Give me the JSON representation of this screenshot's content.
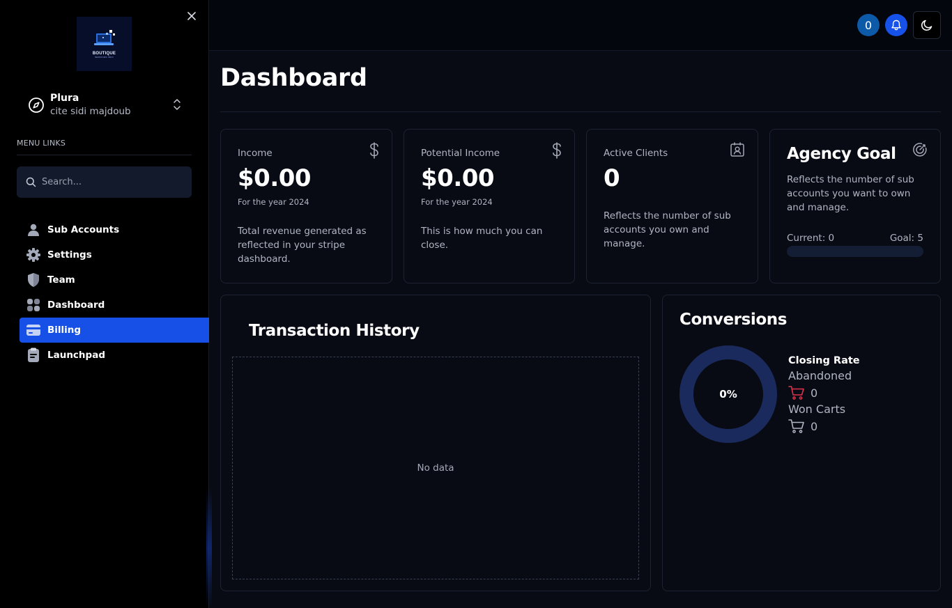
{
  "sidebar": {
    "logo": {
      "text": "BOUTIQUE",
      "sub": "SERVICES INFO"
    },
    "account": {
      "name": "Plura",
      "subtitle": "cite sidi majdoub"
    },
    "menu_heading": "MENU LINKS",
    "search_placeholder": "Search...",
    "items": [
      {
        "label": "Sub Accounts",
        "icon": "user-icon",
        "active": false
      },
      {
        "label": "Settings",
        "icon": "gear-icon",
        "active": false
      },
      {
        "label": "Team",
        "icon": "shield-icon",
        "active": false
      },
      {
        "label": "Dashboard",
        "icon": "grid-icon",
        "active": false
      },
      {
        "label": "Billing",
        "icon": "credit-card-icon",
        "active": true
      },
      {
        "label": "Launchpad",
        "icon": "clipboard-icon",
        "active": false
      }
    ]
  },
  "topbar": {
    "notification_count": "0"
  },
  "page": {
    "title": "Dashboard"
  },
  "stats": {
    "income": {
      "label": "Income",
      "value": "$0.00",
      "sub": "For the year 2024",
      "desc": "Total revenue generated as reflected in your stripe dashboard."
    },
    "potential": {
      "label": "Potential Income",
      "value": "$0.00",
      "sub": "For the year 2024",
      "desc": "This is how much you can close."
    },
    "clients": {
      "label": "Active Clients",
      "value": "0",
      "desc": "Reflects the number of sub accounts you own and manage."
    }
  },
  "goal": {
    "title": "Agency Goal",
    "desc": "Reflects the number of sub accounts you want to own and manage.",
    "current_label": "Current: 0",
    "goal_label": "Goal: 5",
    "progress": 0
  },
  "transactions": {
    "title": "Transaction History",
    "empty": "No data"
  },
  "conversions": {
    "title": "Conversions",
    "rate": "0%",
    "closing_label": "Closing Rate",
    "abandoned_label": "Abandoned",
    "abandoned_value": "0",
    "won_label": "Won Carts",
    "won_value": "0"
  },
  "colors": {
    "accent": "#1650e6",
    "donut": "#1b2a5c",
    "abandoned_cart": "#e0334f"
  }
}
